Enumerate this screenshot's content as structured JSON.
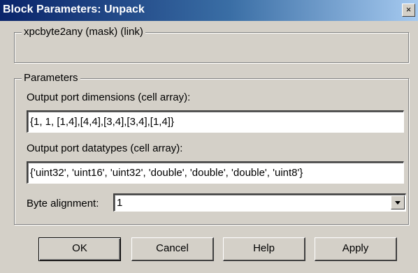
{
  "window": {
    "title": "Block Parameters: Unpack",
    "close_glyph": "×"
  },
  "mask_group": {
    "legend": "xpcbyte2any (mask) (link)"
  },
  "parameters": {
    "legend": "Parameters",
    "output_dims_label": "Output port dimensions (cell array):",
    "output_dims_value": "{1, 1, [1,4],[4,4],[3,4],[3,4],[1,4]}",
    "output_types_label": "Output port datatypes (cell array):",
    "output_types_value": "{'uint32', 'uint16', 'uint32', 'double', 'double', 'double', 'uint8'}",
    "byte_alignment_label": "Byte alignment:",
    "byte_alignment_value": "1"
  },
  "buttons": {
    "ok": "OK",
    "cancel": "Cancel",
    "help": "Help",
    "apply": "Apply"
  }
}
